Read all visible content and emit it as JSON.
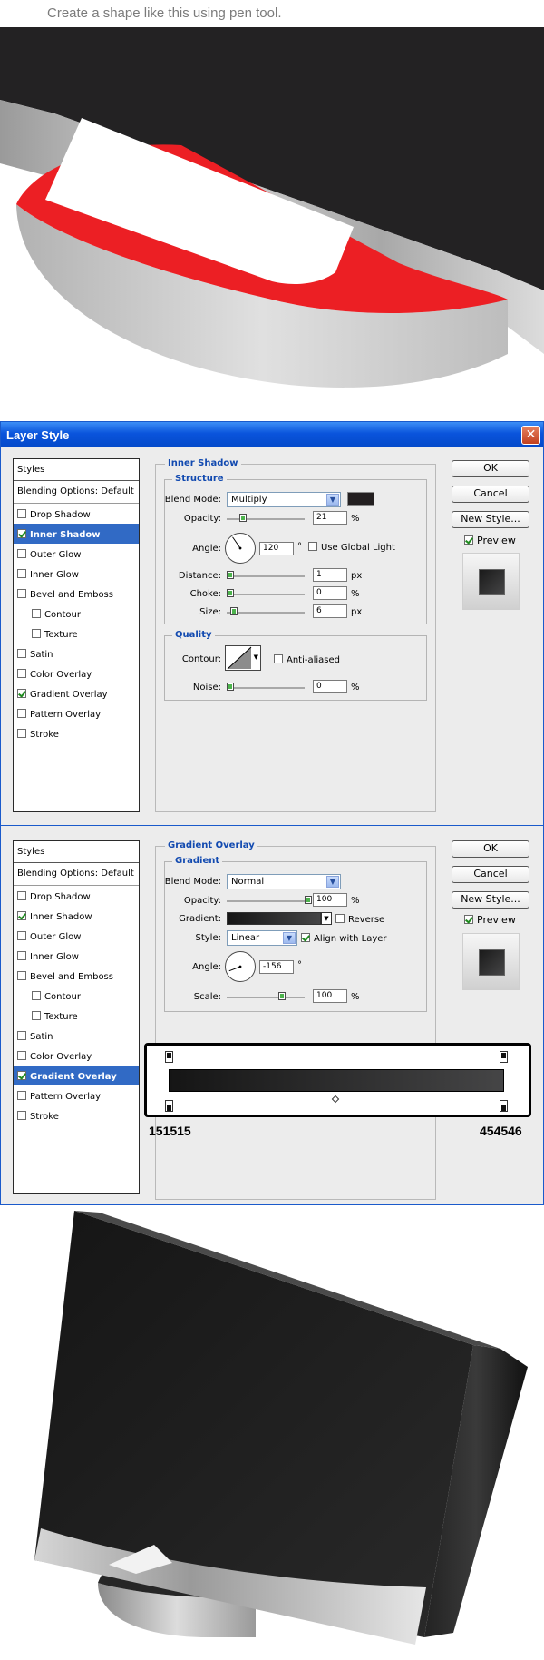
{
  "caption": "Create a shape like this using pen tool.",
  "window": {
    "title": "Layer Style",
    "close_glyph": "✕"
  },
  "buttons": {
    "ok": "OK",
    "cancel": "Cancel",
    "new_style": "New Style...",
    "preview": "Preview"
  },
  "style_list": {
    "header": "Styles",
    "blending": "Blending Options: Default",
    "items": [
      "Drop Shadow",
      "Inner Shadow",
      "Outer Glow",
      "Inner Glow",
      "Bevel and Emboss",
      "Contour",
      "Texture",
      "Satin",
      "Color Overlay",
      "Gradient Overlay",
      "Pattern Overlay",
      "Stroke"
    ]
  },
  "dialog1": {
    "selected": "Inner Shadow",
    "checked": [
      "Inner Shadow",
      "Gradient Overlay"
    ],
    "panel_title": "Inner Shadow",
    "structure": {
      "title": "Structure",
      "blend_mode_label": "Blend Mode:",
      "blend_mode": "Multiply",
      "opacity_label": "Opacity:",
      "opacity": "21",
      "opacity_unit": "%",
      "angle_label": "Angle:",
      "angle": "120",
      "angle_unit": "°",
      "global_light": "Use Global Light",
      "distance_label": "Distance:",
      "distance": "1",
      "distance_unit": "px",
      "choke_label": "Choke:",
      "choke": "0",
      "choke_unit": "%",
      "size_label": "Size:",
      "size": "6",
      "size_unit": "px",
      "shadow_color": "#231f20",
      "opacity_fraction": 0.21
    },
    "quality": {
      "title": "Quality",
      "contour_label": "Contour:",
      "anti_aliased": "Anti-aliased",
      "noise_label": "Noise:",
      "noise": "0",
      "noise_unit": "%"
    }
  },
  "dialog2": {
    "selected": "Gradient Overlay",
    "checked": [
      "Inner Shadow",
      "Gradient Overlay"
    ],
    "panel_title": "Gradient Overlay",
    "gradient": {
      "title": "Gradient",
      "blend_mode_label": "Blend Mode:",
      "blend_mode": "Normal",
      "opacity_label": "Opacity:",
      "opacity": "100",
      "opacity_unit": "%",
      "gradient_label": "Gradient:",
      "reverse": "Reverse",
      "style_label": "Style:",
      "style": "Linear",
      "align": "Align with Layer",
      "angle_label": "Angle:",
      "angle": "-156",
      "angle_unit": "°",
      "scale_label": "Scale:",
      "scale": "100",
      "scale_unit": "%"
    },
    "editor": {
      "left_hex": "151515",
      "right_hex": "454546",
      "left_color": "#151515",
      "right_color": "#454546"
    }
  },
  "colors": {
    "accent_red": "#ec1f24",
    "selection_blue": "#316ac5",
    "dark_body": "#1d1d1d"
  },
  "icons": {
    "close": "close-icon",
    "dropdown": "chevron-down-icon",
    "checkbox": "checkbox-icon",
    "dial": "angle-dial-icon"
  }
}
